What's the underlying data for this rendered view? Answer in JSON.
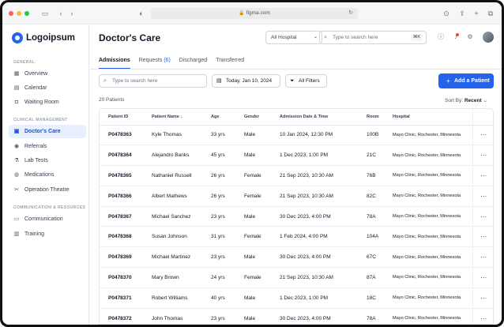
{
  "browser": {
    "url": "figma.com"
  },
  "sidebar": {
    "logo": "Logoipsum",
    "sections": [
      {
        "label": "GENERAL"
      },
      {
        "label": "CLINICAL MANAGEMENT"
      },
      {
        "label": "COMMUNICATION & RESOURCES"
      }
    ],
    "items": [
      {
        "label": "Overview",
        "icon": "grid-icon"
      },
      {
        "label": "Calendar",
        "icon": "calendar-icon"
      },
      {
        "label": "Waiting Room",
        "icon": "camera-icon"
      },
      {
        "label": "Doctor's Care",
        "icon": "doctor-icon",
        "active": true
      },
      {
        "label": "Referrals",
        "icon": "referral-icon"
      },
      {
        "label": "Lab Tests",
        "icon": "flask-icon"
      },
      {
        "label": "Medications",
        "icon": "pill-icon"
      },
      {
        "label": "Operation Theatre",
        "icon": "scissors-icon"
      },
      {
        "label": "Communication",
        "icon": "message-icon"
      },
      {
        "label": "Training",
        "icon": "book-icon"
      }
    ]
  },
  "header": {
    "title": "Doctor's Care",
    "hospital_select": "All Hospital",
    "search_placeholder": "Type to search here",
    "shortcut": "⌘K"
  },
  "tabs": [
    {
      "label": "Admissions",
      "active": true
    },
    {
      "label": "Requests",
      "count": "(6)"
    },
    {
      "label": "Discharged"
    },
    {
      "label": "Transferred"
    }
  ],
  "filters": {
    "search_placeholder": "Type to search here",
    "date": "Today, Jan 10, 2024",
    "all_filters": "All Filters",
    "add_button": "Add a Patient"
  },
  "summary": {
    "count_label": "20 Patients",
    "sort_label": "Sort By:",
    "sort_value": "Recent"
  },
  "table": {
    "columns": [
      "Patient ID",
      "Patient Name ↓",
      "Age",
      "Gender",
      "Admission Date & Time",
      "Room",
      "Hospital"
    ],
    "rows": [
      [
        "P0478363",
        "Kyle Thomas",
        "33 yrs",
        "Male",
        "10 Jan 2024, 12:30 PM",
        "100B",
        "Mayo Clinic, Rochester, Minnesota"
      ],
      [
        "P0478364",
        "Alejandro Banks",
        "45 yrs",
        "Male",
        "1 Dec 2023, 1:00 PM",
        "21C",
        "Mayo Clinic, Rochester, Minnesota"
      ],
      [
        "P0478365",
        "Nathaniel Russell",
        "26 yrs",
        "Female",
        "21 Sep 2023, 10:30 AM",
        "76B",
        "Mayo Clinic, Rochester, Minnesota"
      ],
      [
        "P0478366",
        "Albert Mathews",
        "26 yrs",
        "Female",
        "21 Sep 2023, 10:30 AM",
        "82C",
        "Mayo Clinic, Rochester, Minnesota"
      ],
      [
        "P0478367",
        "Michael Sanchez",
        "23 yrs",
        "Male",
        "30 Dec 2023, 4:00 PM",
        "78A",
        "Mayo Clinic, Rochester, Minnesota"
      ],
      [
        "P0478368",
        "Susan Johnson",
        "31 yrs",
        "Female",
        "1 Feb 2024, 4:00 PM",
        "104A",
        "Mayo Clinic, Rochester, Minnesota"
      ],
      [
        "P0478369",
        "Michael Martinez",
        "23 yrs",
        "Male",
        "30 Dec 2023, 4:00 PM",
        "67C",
        "Mayo Clinic, Rochester, Minnesota"
      ],
      [
        "P0478370",
        "Mary Brown",
        "24 yrs",
        "Female",
        "21 Sep 2023, 10:30 AM",
        "87A",
        "Mayo Clinic, Rochester, Minnesota"
      ],
      [
        "P0478371",
        "Robert Williams",
        "40 yrs",
        "Male",
        "1 Dec 2023, 1:00 PM",
        "18C",
        "Mayo Clinic, Rochester, Minnesota"
      ],
      [
        "P0478372",
        "John Thomas",
        "23 yrs",
        "Male",
        "30 Dec 2023, 4:00 PM",
        "78A",
        "Mayo Clinic, Rochester, Minnesota"
      ]
    ],
    "row_action": "⋯"
  },
  "colors": {
    "accent": "#2563eb",
    "active_bg": "#e8efff",
    "notification": "#ef4444"
  }
}
